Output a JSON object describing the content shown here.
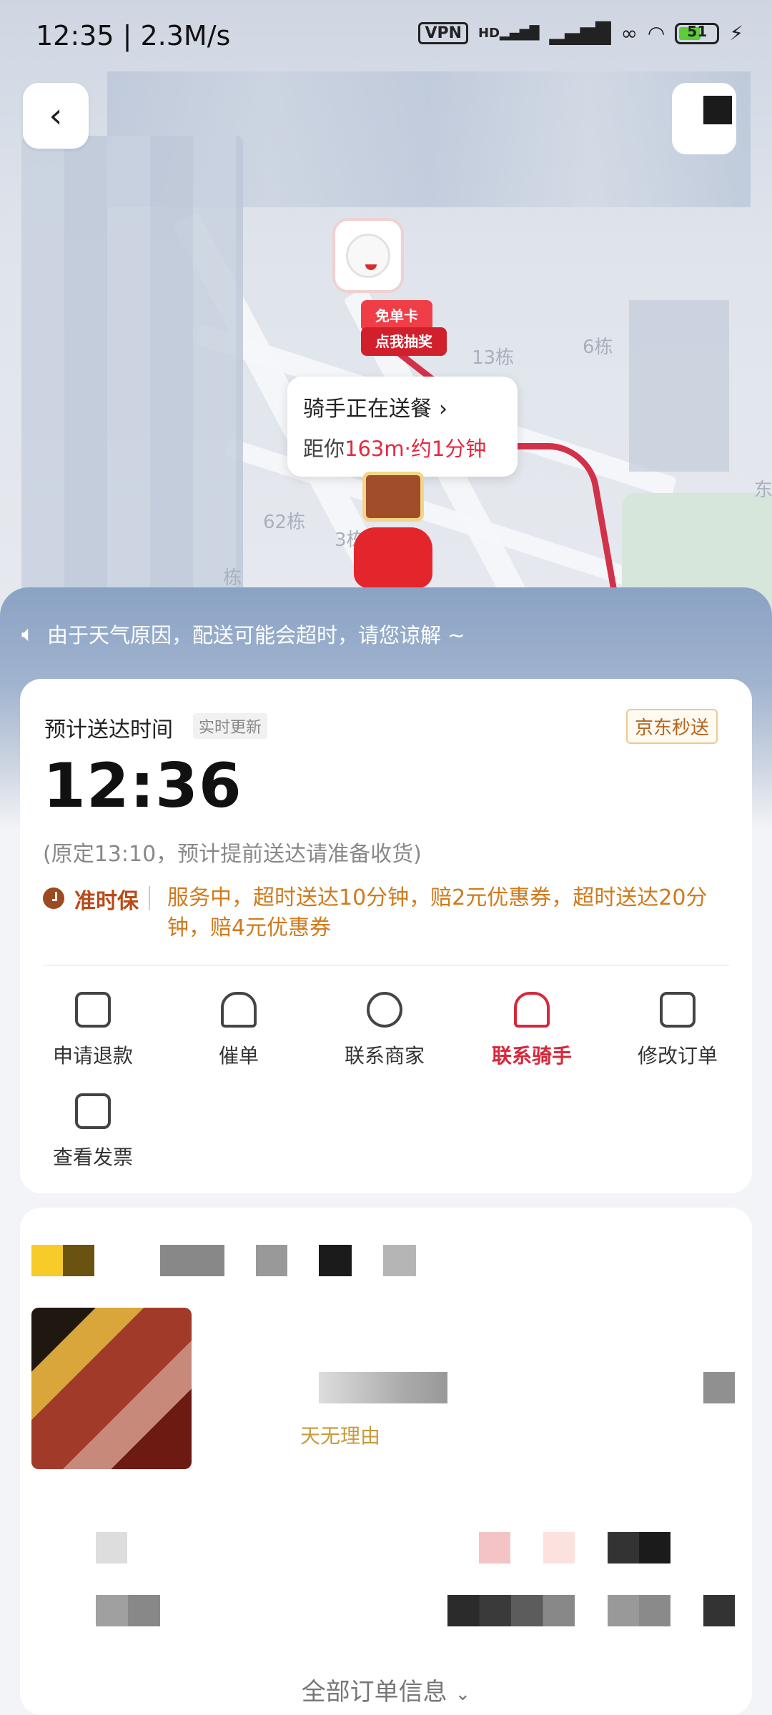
{
  "status_bar": {
    "time": "12:35 | 2.3M/s",
    "vpn": "VPN",
    "hd": "HD",
    "battery": "51"
  },
  "map": {
    "labels": [
      "13栋",
      "62栋",
      "3栋",
      "6栋",
      "栋",
      "东"
    ],
    "coupon_label": "免单卡",
    "lottery_label": "点我抽奖",
    "rider_bubble": {
      "title": "骑手正在送餐",
      "distance_prefix": "距你",
      "distance_value": "163m·约1分钟"
    }
  },
  "notice": {
    "text": "由于天气原因，配送可能会超时，请您谅解 ~"
  },
  "delivery_card": {
    "eta_label": "预计送达时间",
    "realtime_badge": "实时更新",
    "service_badge": "京东秒送",
    "eta_time": "12:36",
    "original_time_note": "(原定13:10，预计提前送达请准备收货)",
    "guarantee_label": "准时保",
    "guarantee_text": "服务中，超时送达10分钟，赔2元优惠券，超时送达20分钟，赔4元优惠券"
  },
  "actions": [
    {
      "label": "申请退款",
      "icon": "refund-icon"
    },
    {
      "label": "催单",
      "icon": "bell-icon"
    },
    {
      "label": "联系商家",
      "icon": "merchant-chat-icon"
    },
    {
      "label": "联系骑手",
      "icon": "rider-helmet-icon",
      "highlight": true
    },
    {
      "label": "修改订单",
      "icon": "edit-order-icon"
    },
    {
      "label": "查看发票",
      "icon": "invoice-icon"
    }
  ],
  "order_section": {
    "all_info_label": "全部订单信息",
    "reason_snippet": "天无理由"
  },
  "colors": {
    "accent_red": "#e22a3e",
    "guarantee_orange": "#d07a1c",
    "service_brown": "#b5651d"
  }
}
